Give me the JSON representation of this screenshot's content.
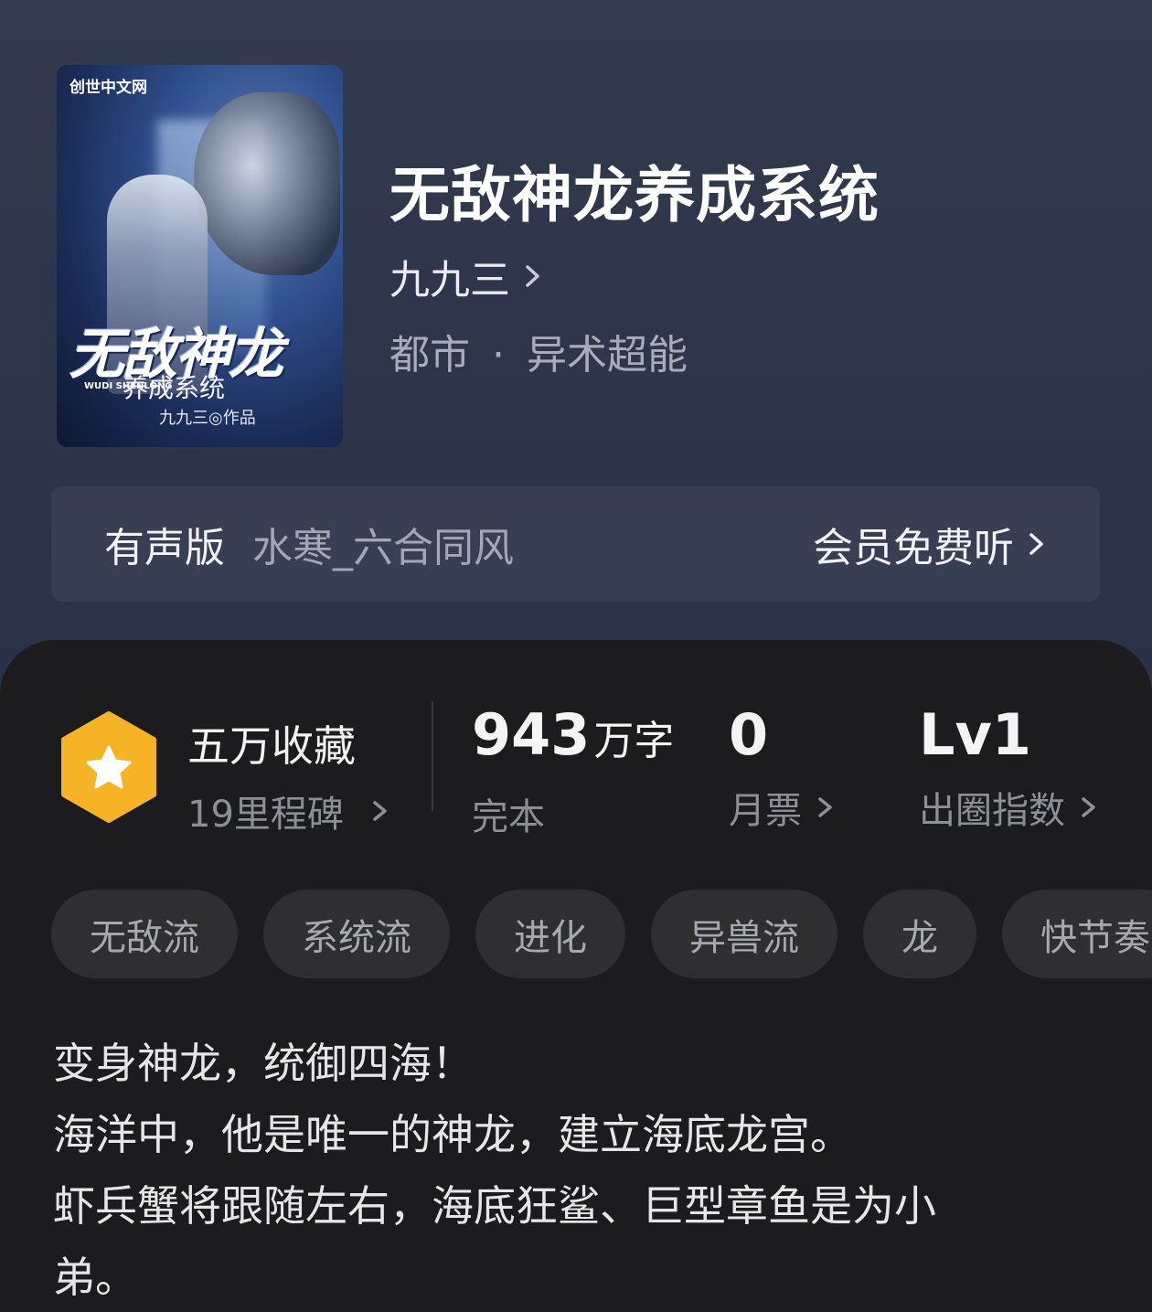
{
  "book": {
    "title": "无敌神龙养成系统",
    "author": "九九三",
    "genre_primary": "都市",
    "genre_separator": "·",
    "genre_secondary": "异术超能"
  },
  "cover": {
    "publisher_logo": "创世中文网",
    "big_title": "无敌神龙",
    "sub_title": "养成系统",
    "pinyin": "WUDI SHENLONG",
    "author_mark": "九九三◎作品"
  },
  "audio": {
    "label": "有声版",
    "narrator": "水寒_六合同风",
    "action": "会员免费听"
  },
  "stats": {
    "favorites": "五万收藏",
    "milestones": "19里程碑",
    "word_count": "943",
    "word_unit": "万字",
    "status": "完本",
    "monthly_tickets": "0",
    "monthly_tickets_label": "月票",
    "level": "Lv1",
    "level_label": "出圈指数"
  },
  "tags": [
    "无敌流",
    "系统流",
    "进化",
    "异兽流",
    "龙",
    "快节奏"
  ],
  "description": [
    "变身神龙，统御四海！",
    "海洋中，他是唯一的神龙，建立海底龙宫。",
    "虾兵蟹将跟随左右，海底狂鲨、巨型章鱼是为小",
    "弟。"
  ],
  "colors": {
    "hero_bg": "#2e364b",
    "panel_bg": "#1c1c1e",
    "badge": "#f5b325",
    "tag_bg": "#2f2f32"
  },
  "icons": {
    "chevron": "chevron-right-icon",
    "badge": "star-hexagon-icon"
  }
}
